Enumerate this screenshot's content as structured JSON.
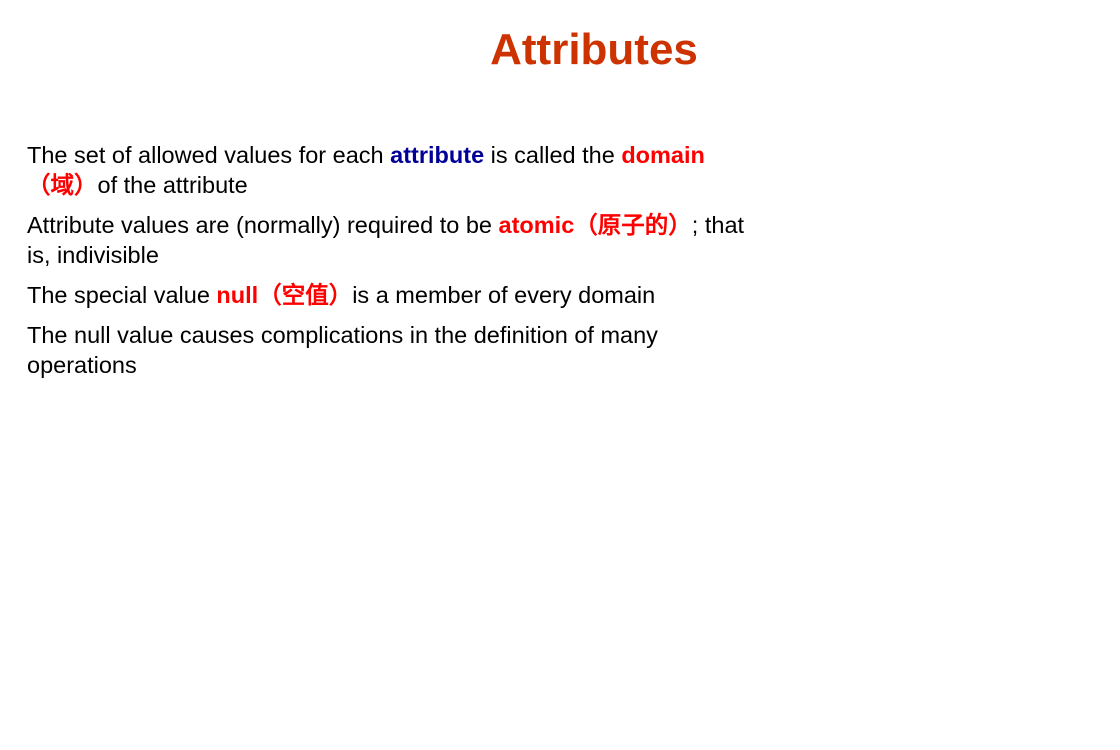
{
  "slide": {
    "title": "Attributes",
    "colors": {
      "title": "#cc3300",
      "keyword_blue": "#000099",
      "keyword_red": "#ff0000",
      "text": "#000000",
      "background": "#ffffff"
    },
    "bullets": [
      {
        "t1": "The set of allowed values for each ",
        "k1": "attribute",
        "t2": " is called the ",
        "k2": "domain",
        "k3": "（域）",
        "t3": "of the attribute"
      },
      {
        "t1": "Attribute values are (normally) required to be ",
        "k1": "atomic（原子的）",
        "t2": "; that is, indivisible"
      },
      {
        "t1": "The special value ",
        "k1": "null（空值）",
        "t2": "is a member of every domain"
      },
      {
        "t1": "The null value causes complications in the definition of many operations"
      }
    ]
  }
}
